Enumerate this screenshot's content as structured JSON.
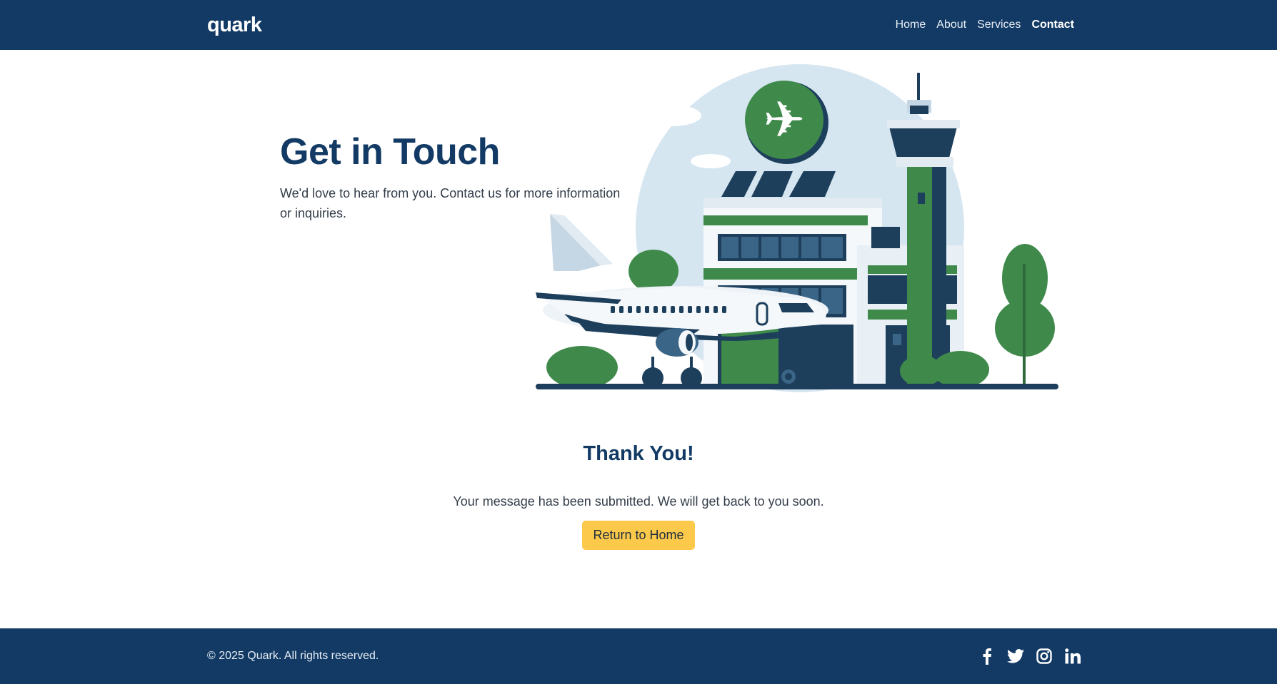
{
  "brand": {
    "logo": "quark"
  },
  "nav": {
    "items": [
      {
        "label": "Home",
        "active": false
      },
      {
        "label": "About",
        "active": false
      },
      {
        "label": "Services",
        "active": false
      },
      {
        "label": "Contact",
        "active": true
      }
    ]
  },
  "hero": {
    "title": "Get in Touch",
    "subtitle": "We'd love to hear from you. Contact us for more information or inquiries."
  },
  "thanks": {
    "title": "Thank You!",
    "message": "Your message has been submitted. We will get back to you soon.",
    "button_label": "Return to Home"
  },
  "footer": {
    "copyright": "© 2025 Quark. All rights reserved.",
    "social": [
      "facebook-icon",
      "twitter-icon",
      "instagram-icon",
      "linkedin-icon"
    ]
  },
  "colors": {
    "primary": "#123a64",
    "accent": "#fcc94b",
    "illustration_green": "#3f8a4a",
    "illustration_navy": "#1d3f5c"
  }
}
